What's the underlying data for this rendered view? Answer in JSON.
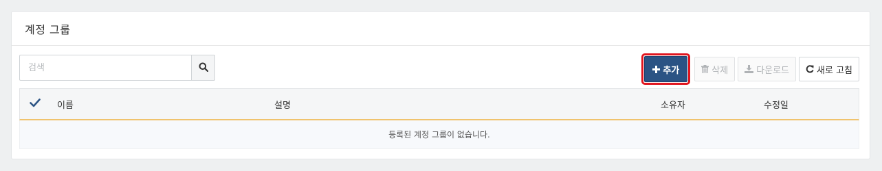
{
  "panel": {
    "title": "계정 그룹"
  },
  "search": {
    "placeholder": "검색",
    "value": ""
  },
  "toolbar": {
    "add_label": "추가",
    "delete_label": "삭제",
    "download_label": "다운로드",
    "refresh_label": "새로 고침"
  },
  "table": {
    "columns": [
      "이름",
      "설명",
      "소유자",
      "수정일"
    ],
    "empty_message": "등록된 계정 그룹이 없습니다."
  },
  "colors": {
    "primary": "#2b5384",
    "highlight_outline": "#e0151e",
    "header_underline": "#f0c36d"
  }
}
